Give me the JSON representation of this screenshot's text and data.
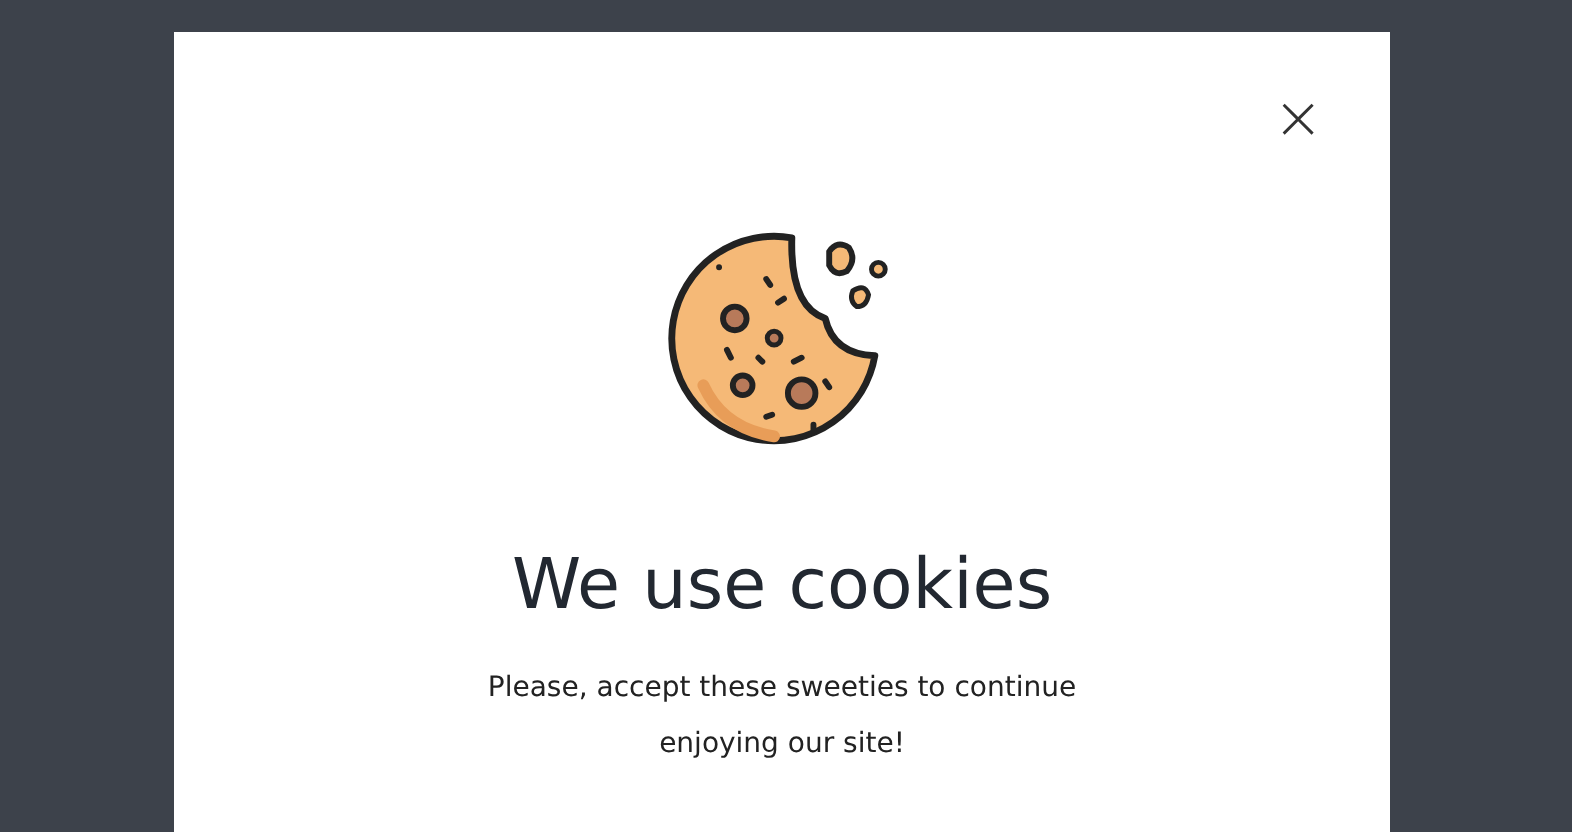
{
  "dialog": {
    "close_label": "×",
    "title": "We use cookies",
    "message": "Please, accept these sweeties to continue enjoying our site!"
  }
}
